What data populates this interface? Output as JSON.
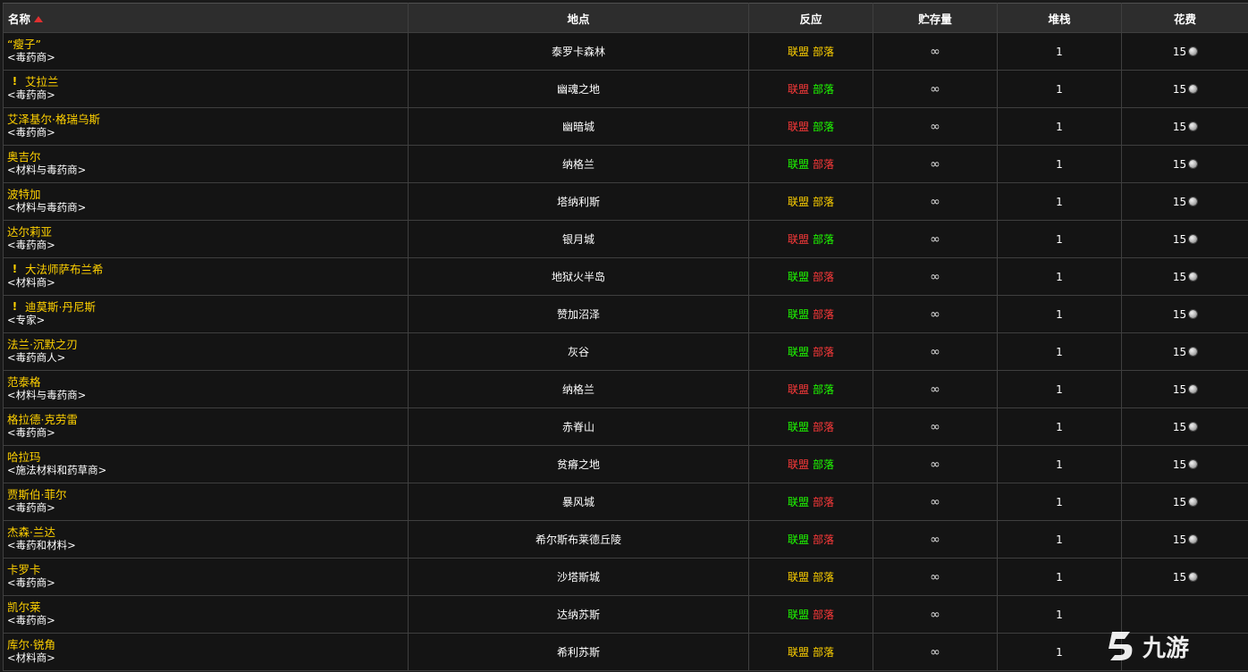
{
  "headers": {
    "name": "名称",
    "location": "地点",
    "reaction": "反应",
    "stock": "贮存量",
    "stack": "堆栈",
    "cost": "花费"
  },
  "colors": {
    "name": "#ffd100",
    "alliance_friendly": "#1eff00",
    "hostile": "#ff3a3a",
    "neutral": "#ffd100"
  },
  "rows": [
    {
      "name": "“瘦子”",
      "title": "<毒药商>",
      "quest": false,
      "location": "泰罗卡森林",
      "alliance": "联盟",
      "horde": "部落",
      "alliance_color": "yellow",
      "horde_color": "yellow",
      "stock": "∞",
      "stack": "1",
      "cost": "15"
    },
    {
      "name": "艾拉兰",
      "title": "<毒药商>",
      "quest": true,
      "location": "幽魂之地",
      "alliance": "联盟",
      "horde": "部落",
      "alliance_color": "red",
      "horde_color": "green",
      "stock": "∞",
      "stack": "1",
      "cost": "15"
    },
    {
      "name": "艾泽基尔·格瑞乌斯",
      "title": "<毒药商>",
      "quest": false,
      "location": "幽暗城",
      "alliance": "联盟",
      "horde": "部落",
      "alliance_color": "red",
      "horde_color": "green",
      "stock": "∞",
      "stack": "1",
      "cost": "15"
    },
    {
      "name": "奥吉尔",
      "title": "<材料与毒药商>",
      "quest": false,
      "location": "纳格兰",
      "alliance": "联盟",
      "horde": "部落",
      "alliance_color": "green",
      "horde_color": "red",
      "stock": "∞",
      "stack": "1",
      "cost": "15"
    },
    {
      "name": "波特加",
      "title": "<材料与毒药商>",
      "quest": false,
      "location": "塔纳利斯",
      "alliance": "联盟",
      "horde": "部落",
      "alliance_color": "yellow",
      "horde_color": "yellow",
      "stock": "∞",
      "stack": "1",
      "cost": "15"
    },
    {
      "name": "达尔莉亚",
      "title": "<毒药商>",
      "quest": false,
      "location": "银月城",
      "alliance": "联盟",
      "horde": "部落",
      "alliance_color": "red",
      "horde_color": "green",
      "stock": "∞",
      "stack": "1",
      "cost": "15"
    },
    {
      "name": "大法师萨布兰希",
      "title": "<材料商>",
      "quest": true,
      "location": "地狱火半岛",
      "alliance": "联盟",
      "horde": "部落",
      "alliance_color": "green",
      "horde_color": "red",
      "stock": "∞",
      "stack": "1",
      "cost": "15"
    },
    {
      "name": "迪莫斯·丹尼斯",
      "title": "<专家>",
      "quest": true,
      "location": "赞加沼泽",
      "alliance": "联盟",
      "horde": "部落",
      "alliance_color": "green",
      "horde_color": "red",
      "stock": "∞",
      "stack": "1",
      "cost": "15"
    },
    {
      "name": "法兰·沉默之刃",
      "title": "<毒药商人>",
      "quest": false,
      "location": "灰谷",
      "alliance": "联盟",
      "horde": "部落",
      "alliance_color": "green",
      "horde_color": "red",
      "stock": "∞",
      "stack": "1",
      "cost": "15"
    },
    {
      "name": "范泰格",
      "title": "<材料与毒药商>",
      "quest": false,
      "location": "纳格兰",
      "alliance": "联盟",
      "horde": "部落",
      "alliance_color": "red",
      "horde_color": "green",
      "stock": "∞",
      "stack": "1",
      "cost": "15"
    },
    {
      "name": "格拉德·克劳雷",
      "title": "<毒药商>",
      "quest": false,
      "location": "赤脊山",
      "alliance": "联盟",
      "horde": "部落",
      "alliance_color": "green",
      "horde_color": "red",
      "stock": "∞",
      "stack": "1",
      "cost": "15"
    },
    {
      "name": "哈拉玛",
      "title": "<施法材料和药草商>",
      "quest": false,
      "location": "贫瘠之地",
      "alliance": "联盟",
      "horde": "部落",
      "alliance_color": "red",
      "horde_color": "green",
      "stock": "∞",
      "stack": "1",
      "cost": "15"
    },
    {
      "name": "贾斯伯·菲尔",
      "title": "<毒药商>",
      "quest": false,
      "location": "暴风城",
      "alliance": "联盟",
      "horde": "部落",
      "alliance_color": "green",
      "horde_color": "red",
      "stock": "∞",
      "stack": "1",
      "cost": "15"
    },
    {
      "name": "杰森·兰达",
      "title": "<毒药和材料>",
      "quest": false,
      "location": "希尔斯布莱德丘陵",
      "alliance": "联盟",
      "horde": "部落",
      "alliance_color": "green",
      "horde_color": "red",
      "stock": "∞",
      "stack": "1",
      "cost": "15"
    },
    {
      "name": "卡罗卡",
      "title": "<毒药商>",
      "quest": false,
      "location": "沙塔斯城",
      "alliance": "联盟",
      "horde": "部落",
      "alliance_color": "yellow",
      "horde_color": "yellow",
      "stock": "∞",
      "stack": "1",
      "cost": "15"
    },
    {
      "name": "凯尔莱",
      "title": "<毒药商>",
      "quest": false,
      "location": "达纳苏斯",
      "alliance": "联盟",
      "horde": "部落",
      "alliance_color": "green",
      "horde_color": "red",
      "stock": "∞",
      "stack": "1",
      "cost": ""
    },
    {
      "name": "库尔·锐角",
      "title": "<材料商>",
      "quest": false,
      "location": "希利苏斯",
      "alliance": "联盟",
      "horde": "部落",
      "alliance_color": "yellow",
      "horde_color": "yellow",
      "stock": "∞",
      "stack": "1",
      "cost": ""
    }
  ],
  "watermark": {
    "text": "九游"
  }
}
